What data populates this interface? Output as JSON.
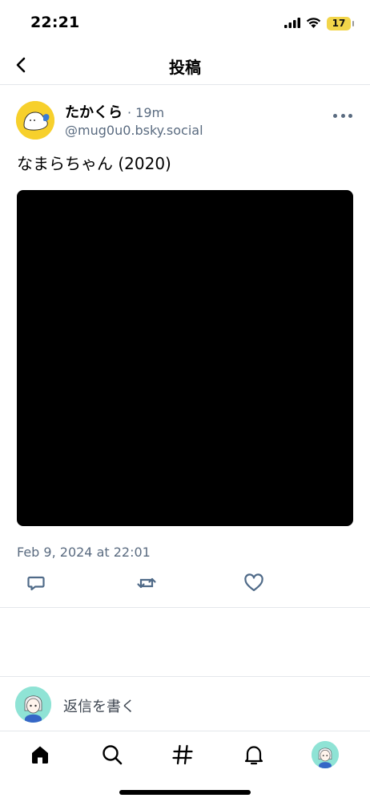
{
  "status_bar": {
    "time": "22:21",
    "battery_level": "17",
    "icons": [
      "signal-icon",
      "wifi-icon",
      "battery-icon"
    ]
  },
  "header": {
    "back_icon": "chevron-left-icon",
    "title": "投稿"
  },
  "post": {
    "author": {
      "display_name": "たかくら",
      "handle": "@mug0u0.bsky.social",
      "avatar_color": "#f7d02c"
    },
    "relative_time": "· 19m",
    "text": "なまらちゃん (2020)",
    "image": {
      "color": "#000000"
    },
    "timestamp": "Feb 9, 2024 at 22:01",
    "actions": [
      "reply-icon",
      "repost-icon",
      "like-icon"
    ]
  },
  "reply_composer": {
    "placeholder": "返信を書く",
    "avatar_color": "#8fe3d5"
  },
  "bottom_nav": {
    "items": [
      "home-icon",
      "search-icon",
      "feeds-hash-icon",
      "notifications-bell-icon",
      "profile-avatar"
    ]
  },
  "colors": {
    "secondary_text": "#5a6b80",
    "divider": "#e4e7eb"
  }
}
